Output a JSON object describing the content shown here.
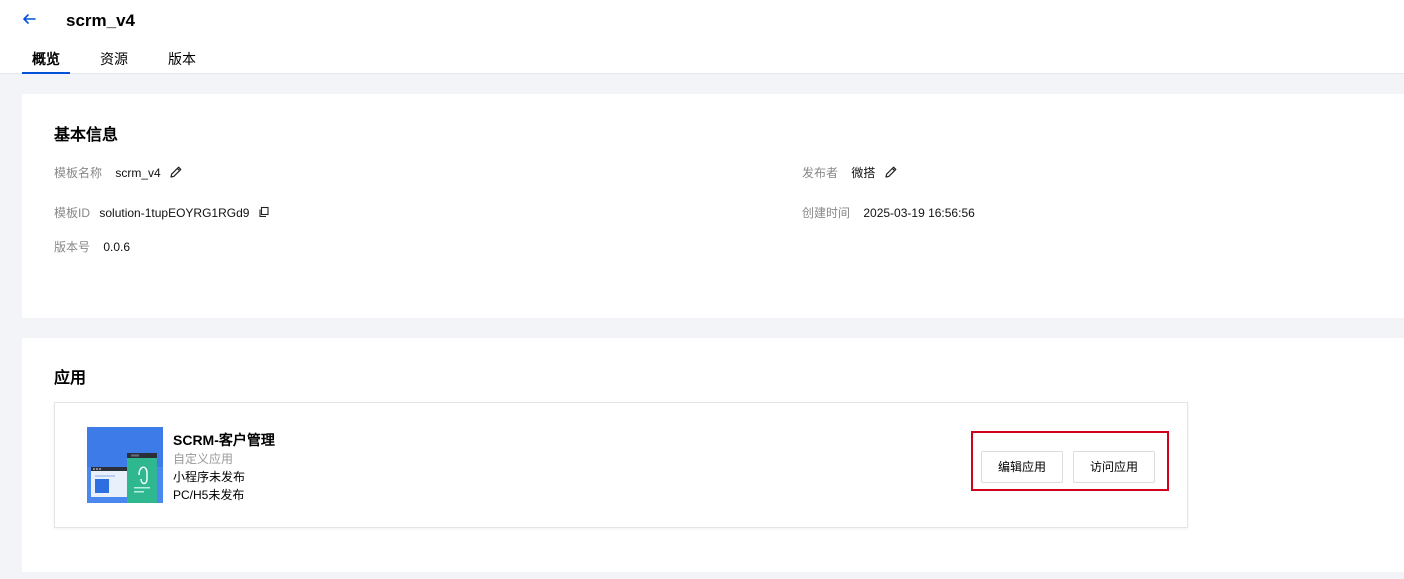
{
  "header": {
    "title": "scrm_v4",
    "tabs": [
      {
        "label": "概览",
        "active": true
      },
      {
        "label": "资源",
        "active": false
      },
      {
        "label": "版本",
        "active": false
      }
    ]
  },
  "basic_info": {
    "title": "基本信息",
    "template_name_label": "模板名称",
    "template_name_value": "scrm_v4",
    "publisher_label": "发布者",
    "publisher_value": "微搭",
    "template_id_label": "模板ID",
    "template_id_value": "solution-1tupEOYRG1RGd9",
    "created_label": "创建时间",
    "created_value": "2025-03-19 16:56:56",
    "version_label": "版本号",
    "version_value": "0.0.6"
  },
  "apps": {
    "title": "应用",
    "items": [
      {
        "name": "SCRM-客户管理",
        "type": "自定义应用",
        "miniprogram_status": "小程序未发布",
        "h5_status": "PC/H5未发布",
        "edit_label": "编辑应用",
        "visit_label": "访问应用"
      }
    ]
  },
  "colors": {
    "accent": "#0052d9",
    "highlight_border": "#d0021b",
    "thumb_blue": "#3d7ce8",
    "thumb_green": "#2fb890"
  },
  "icons": {
    "back": "arrow-left-icon",
    "edit": "pencil-icon",
    "copy": "copy-icon"
  }
}
